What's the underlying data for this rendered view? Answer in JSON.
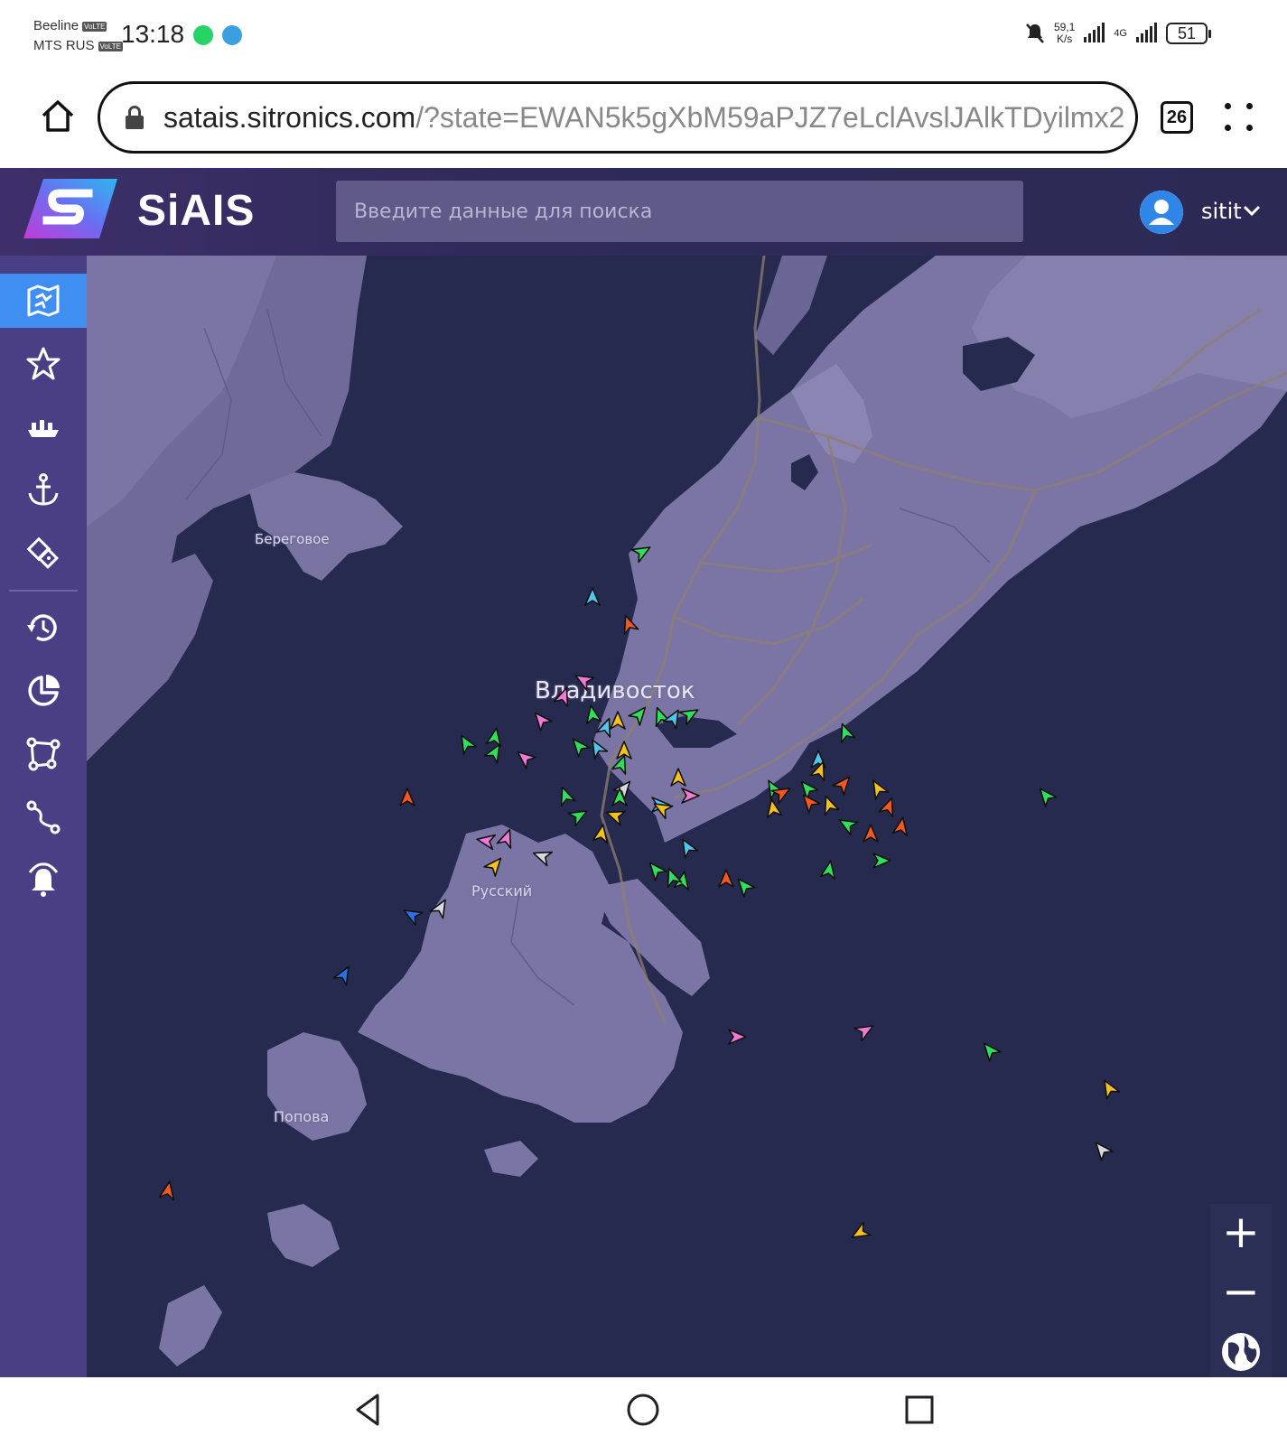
{
  "status_bar": {
    "carrier_1": "Beeline",
    "carrier_2": "MTS RUS",
    "volte": "VoLTE",
    "time": "13:18",
    "net_speed_value": "59,1",
    "net_speed_unit": "K/s",
    "network_type": "4G",
    "battery": "51"
  },
  "browser": {
    "url_host": "satais.sitronics.com",
    "url_rest": "/?state=EWAN5k5gXbM59aPJZ7eLclAvslJAlkTDyilmx2",
    "tab_count": "26"
  },
  "app": {
    "logo_text": "SiAIS",
    "search": {
      "placeholder": "Введите данные для поиска"
    },
    "user": {
      "name": "sitit"
    }
  },
  "sidebar": {
    "items": [
      {
        "icon": "map-icon",
        "active": true
      },
      {
        "icon": "star-icon",
        "active": false
      },
      {
        "icon": "ship-icon",
        "active": false
      },
      {
        "icon": "anchor-icon",
        "active": false
      },
      {
        "icon": "buoy-navigation-icon",
        "active": false
      },
      {
        "icon": "history-icon",
        "active": false
      },
      {
        "icon": "pie-chart-icon",
        "active": false
      },
      {
        "icon": "polygon-icon",
        "active": false
      },
      {
        "icon": "route-icon",
        "active": false
      },
      {
        "icon": "alert-bell-icon",
        "active": false
      }
    ]
  },
  "map": {
    "labels": {
      "berezovoe": "Береговое",
      "vladivostok": "Владивосток",
      "russky": "Русский",
      "popova": "Попова"
    },
    "zoom_in": "+",
    "zoom_out": "−"
  },
  "vessel_colors": {
    "green": "#2fe05a",
    "cyan": "#4fc6ee",
    "orange": "#f2581f",
    "pink": "#f07ad6",
    "yellow": "#f5c21a",
    "white": "#d8d8e0",
    "blue": "#2a72e8"
  }
}
